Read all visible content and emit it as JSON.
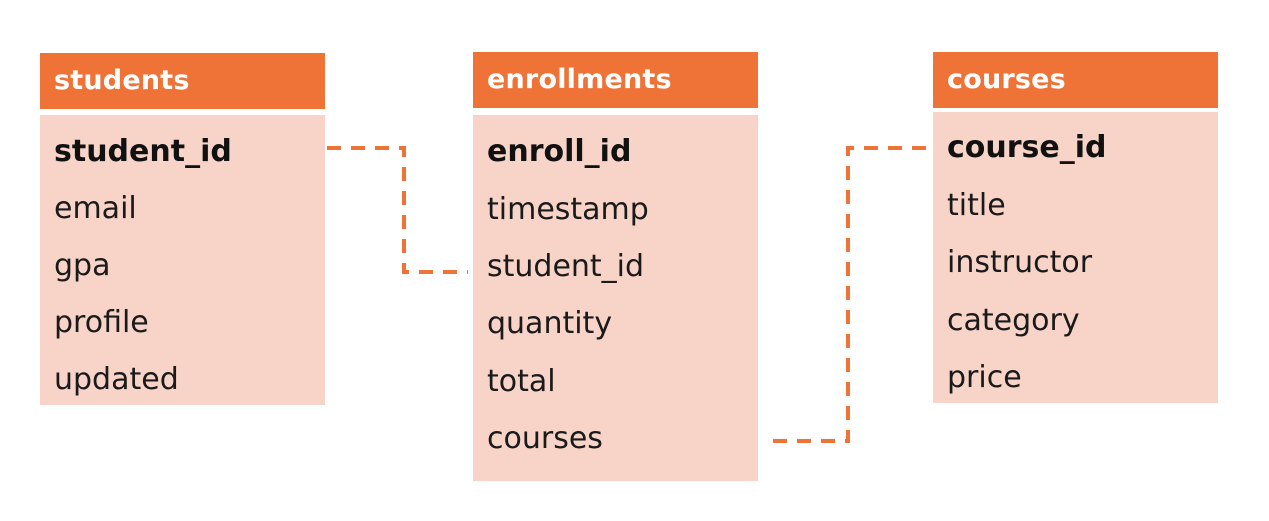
{
  "colors": {
    "header": "#ef7236",
    "body": "#f7d3c8",
    "connector": "#ef7236"
  },
  "tables": {
    "students": {
      "name": "students",
      "fields": [
        "student_id",
        "email",
        "gpa",
        "profile",
        "updated"
      ]
    },
    "enrollments": {
      "name": "enrollments",
      "fields": [
        "enroll_id",
        "timestamp",
        "student_id",
        "quantity",
        "total",
        "courses"
      ]
    },
    "courses": {
      "name": "courses",
      "fields": [
        "course_id",
        "title",
        "instructor",
        "category",
        "price"
      ]
    }
  },
  "relationships": [
    {
      "from": "students.student_id",
      "to": "enrollments.student_id"
    },
    {
      "from": "enrollments.courses",
      "to": "courses.course_id"
    }
  ]
}
